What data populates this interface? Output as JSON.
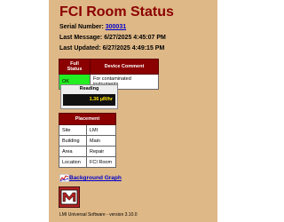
{
  "page": {
    "title": "FCI Room Status",
    "serial_label": "Serial Number:",
    "serial_value": "300031",
    "last_message_label": "Last Message:",
    "last_message_value": "6/27/2025 4:45:07 PM",
    "last_updated_label": "Last Updated:",
    "last_updated_value": "6/27/2025 4:49:15 PM"
  },
  "status": {
    "headers": [
      "Full Status",
      "Device Comment"
    ],
    "row": [
      "OK",
      "For contaminated instruments"
    ],
    "ok_color": "#22ee22"
  },
  "reading": {
    "label": "Reading",
    "value": "1.36 µR/hr"
  },
  "placement": {
    "header": "Placement",
    "rows": [
      [
        "Site",
        "LMI"
      ],
      [
        "Building",
        "Main"
      ],
      [
        "Area",
        "Repair"
      ],
      [
        "Location",
        "FCI Room"
      ]
    ]
  },
  "links": {
    "background_graph": "Background Graph",
    "graph_icon": "chart-icon"
  },
  "logo": {
    "text": "LMI",
    "color": "#b22222"
  },
  "footer": {
    "text": "LMI Universal Software - version 3.10.0"
  },
  "colors": {
    "panel_bg": "#deb887",
    "title": "#8b0000",
    "header_bg": "#8b0000"
  }
}
